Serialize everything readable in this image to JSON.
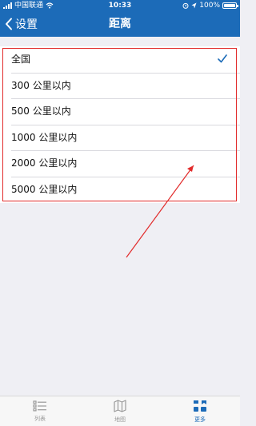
{
  "status_bar": {
    "carrier": "中国联通",
    "time": "10:33",
    "battery": "100%",
    "battery_level": 1.0
  },
  "nav": {
    "back_label": "设置",
    "title": "距离"
  },
  "distance_options": [
    {
      "label": "全国",
      "selected": true
    },
    {
      "label": "300 公里以内",
      "selected": false
    },
    {
      "label": "500 公里以内",
      "selected": false
    },
    {
      "label": "1000 公里以内",
      "selected": false
    },
    {
      "label": "2000 公里以内",
      "selected": false
    },
    {
      "label": "5000 公里以内",
      "selected": false
    }
  ],
  "tab_bar": {
    "tabs": [
      {
        "label": "列表",
        "icon": "list-icon",
        "active": false
      },
      {
        "label": "地图",
        "icon": "map-icon",
        "active": false
      },
      {
        "label": "更多",
        "icon": "more-icon",
        "active": true
      }
    ]
  },
  "colors": {
    "nav_background": "#1c6bb8",
    "accent": "#1c6bb8",
    "annotation": "#e22b2b"
  }
}
